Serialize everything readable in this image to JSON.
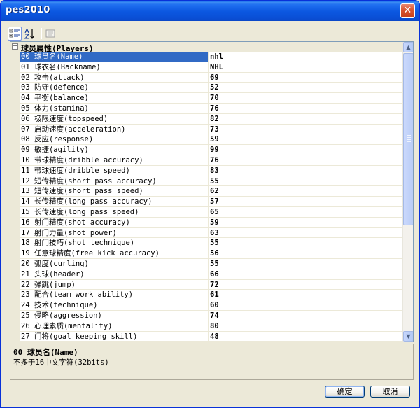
{
  "window": {
    "title": "pes2010",
    "close_glyph": "✕"
  },
  "toolbar": {
    "buttons": [
      {
        "icon": "categorized-icon",
        "active": true
      },
      {
        "icon": "alphabetical-sort-icon",
        "active": false
      },
      {
        "icon": "property-pages-icon",
        "active": false,
        "disabled": true
      }
    ]
  },
  "category": {
    "toggle": "−",
    "label": "球员属性(Players)"
  },
  "rows": [
    {
      "name": "00 球员名(Name)",
      "value": "nhl"
    },
    {
      "name": "01 球衣名(Backname)",
      "value": "NHL"
    },
    {
      "name": "02 攻击(attack)",
      "value": "69"
    },
    {
      "name": "03 防守(defence)",
      "value": "52"
    },
    {
      "name": "04 平衡(balance)",
      "value": "70"
    },
    {
      "name": "05 体力(stamina)",
      "value": "76"
    },
    {
      "name": "06 极限速度(topspeed)",
      "value": "82"
    },
    {
      "name": "07 启动速度(acceleration)",
      "value": "73"
    },
    {
      "name": "08 反应(response)",
      "value": "59"
    },
    {
      "name": "09 敏捷(agility)",
      "value": "99"
    },
    {
      "name": "10 带球精度(dribble accuracy)",
      "value": "76"
    },
    {
      "name": "11 带球速度(dribble speed)",
      "value": "83"
    },
    {
      "name": "12 短传精度(short pass accuracy)",
      "value": "55"
    },
    {
      "name": "13 短传速度(short pass speed)",
      "value": "62"
    },
    {
      "name": "14 长传精度(long pass accuracy)",
      "value": "57"
    },
    {
      "name": "15 长传速度(long pass speed)",
      "value": "65"
    },
    {
      "name": "16 射门精度(shot accuracy)",
      "value": "59"
    },
    {
      "name": "17 射门力量(shot power)",
      "value": "63"
    },
    {
      "name": "18 射门技巧(shot technique)",
      "value": "55"
    },
    {
      "name": "19 任意球精度(free kick accuracy)",
      "value": "56"
    },
    {
      "name": "20 弧度(curling)",
      "value": "55"
    },
    {
      "name": "21 头球(header)",
      "value": "66"
    },
    {
      "name": "22 弹跳(jump)",
      "value": "72"
    },
    {
      "name": "23 配合(team work ability)",
      "value": "61"
    },
    {
      "name": "24 技术(technique)",
      "value": "60"
    },
    {
      "name": "25 侵略(aggression)",
      "value": "74"
    },
    {
      "name": "26 心理素质(mentality)",
      "value": "80"
    },
    {
      "name": "27 门将(goal keeping skill)",
      "value": "48"
    }
  ],
  "selected_index": 0,
  "scrollbar": {
    "up_glyph": "▲",
    "down_glyph": "▼"
  },
  "description": {
    "title": "00 球员名(Name)",
    "text": "不多于16中文字符(32bits)"
  },
  "buttons": {
    "ok": "确定",
    "cancel": "取消"
  },
  "colors": {
    "selection": "#316ac5",
    "titlebar": "#0b57e0",
    "panel": "#ece9d8",
    "grid_border": "#7f9db9"
  }
}
